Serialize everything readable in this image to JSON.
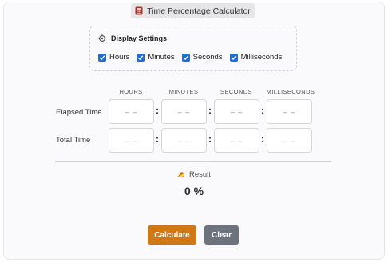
{
  "app": {
    "title": "Time Percentage Calculator"
  },
  "settings": {
    "heading": "Display Settings",
    "options": [
      {
        "label": "Hours",
        "checked": true
      },
      {
        "label": "Minutes",
        "checked": true
      },
      {
        "label": "Seconds",
        "checked": true
      },
      {
        "label": "Milliseconds",
        "checked": true
      }
    ]
  },
  "columns": [
    "HOURS",
    "MINUTES",
    "SECONDS",
    "MILLISECONDS"
  ],
  "rows": [
    {
      "label": "Elapsed Time",
      "values": [
        "– –",
        "– –",
        "– –",
        "– –"
      ]
    },
    {
      "label": "Total Time",
      "values": [
        "– –",
        "– –",
        "– –",
        "– –"
      ]
    }
  ],
  "result": {
    "label": "Result",
    "value": "0 %"
  },
  "buttons": {
    "calculate": "Calculate",
    "clear": "Clear"
  },
  "colors": {
    "accent": "#d07816",
    "checkbox": "#1f6fd1",
    "clear": "#6c737d"
  }
}
